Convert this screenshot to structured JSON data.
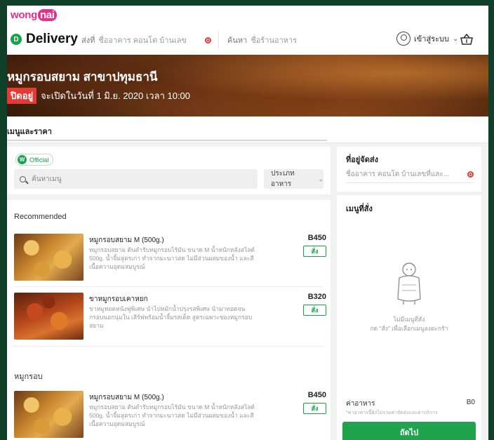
{
  "header": {
    "logo_text": "wong",
    "logo_badge": "nai",
    "brand_mark": "D",
    "brand_name": "Delivery",
    "location": {
      "prefix": "ส่งที่",
      "placeholder": "ชื่ออาคาร คอนโด บ้านเลข",
      "icon": "location-pin-icon"
    },
    "search": {
      "prefix": "ค้นหา",
      "placeholder": "ชื่อร้านอาหาร"
    },
    "user": {
      "label": "เข้าสู่ระบบ",
      "icon": "user-icon"
    },
    "cart_icon": "basket-icon"
  },
  "hero": {
    "title": "หมูกรอบสยาม สาขาปทุมธานี",
    "status_badge": "ปิดอยู่",
    "status_text": "จะเปิดในวันที่ 1 มิ.ย. 2020 เวลา 10:00"
  },
  "tabs": {
    "active": "เมนูและราคา"
  },
  "menu": {
    "official_mark": "W",
    "official_label": "Official",
    "search_placeholder": "ค้นหาเมนู",
    "category_select": "ประเภทอาหาร",
    "sections": [
      {
        "title": "Recommended",
        "items": [
          {
            "name": "หมูกรอบสยาม M (500g.)",
            "description": "หมูกรอบสยาม ต้นตำรับหมูกรอบไร้มัน ขนาด M น้ำหนักหลังสไลด์ 500g. น้ำจิ้มสูตรเก่า ทำจากมะนาวสด ไม่มีส่วนผสมของน้ำ และสีเนื้อความอุดมสมบูรณ์",
            "price": "B450",
            "order_label": "สั่ง",
            "image": "crispy-pork-photo"
          },
          {
            "name": "ขาหมูกรอบเคาหยก",
            "description": "ขาหมูทอดหนังฟูพิเศษ นำไปหมักน้ำปรุงรสพิเศษ นำมาทอดจนกรอบนอกนุ่มใน เสิร์ฟพร้อมน้ำจิ้มรสเด็ด สูตรเฉพาะของหมูกรอบสยาม",
            "price": "B320",
            "order_label": "สั่ง",
            "image": "pork-leg-photo"
          }
        ]
      },
      {
        "title": "หมูกรอบ",
        "items": [
          {
            "name": "หมูกรอบสยาม M (500g.)",
            "description": "หมูกรอบสยาม ต้นตำรับหมูกรอบไร้มัน ขนาด M น้ำหนักหลังสไลด์ 500g. น้ำจิ้มสูตรเก่า ทำจากมะนาวสด ไม่มีส่วนผสมของน้ำ และสีเนื้อความอุดมสมบูรณ์",
            "price": "B450",
            "order_label": "สั่ง",
            "image": "crispy-pork-photo"
          }
        ]
      }
    ]
  },
  "delivery": {
    "title": "ที่อยู่จัดส่ง",
    "placeholder": "ชื่ออาคาร คอนโด บ้านเลขที่และ...",
    "icon": "location-pin-icon"
  },
  "order": {
    "title": "เมนูที่สั่ง",
    "empty_line1": "ไม่มีเมนูที่สั่ง",
    "empty_line2": "กด \"สั่ง\" เพื่อเลือกเมนูลงตะกร้า",
    "fee_label": "ค่าอาหาร",
    "fee_value": "B0",
    "fee_note": "*ค่าอาหารนี้ยังไม่รวมค่าจัดส่งและค่าบริการ",
    "checkout_label": "ถัดไป"
  },
  "colors": {
    "brand_green": "#1fa34d",
    "brand_pink": "#e8308a",
    "closed_red": "#e53935"
  }
}
